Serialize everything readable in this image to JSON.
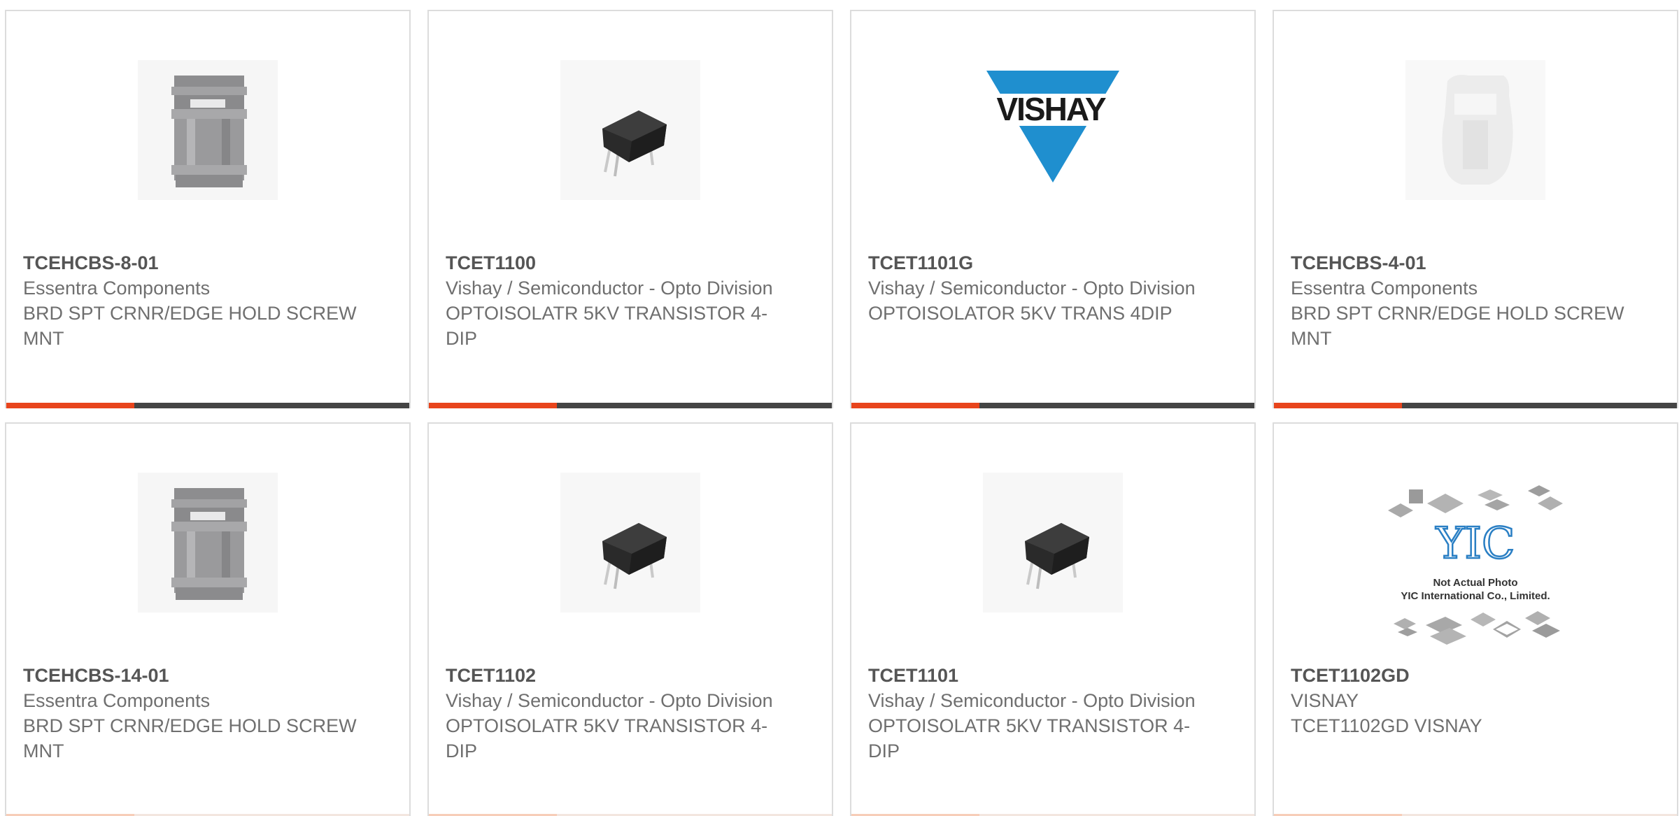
{
  "products": [
    {
      "image": "standoff-gray-icon",
      "part_number": "TCEHCBS-8-01",
      "manufacturer": "Essentra Components",
      "description": "BRD SPT CRNR/EDGE HOLD SCREW MNT"
    },
    {
      "image": "dip-optocoupler-icon",
      "part_number": "TCET1100",
      "manufacturer": "Vishay / Semiconductor - Opto Division",
      "description": "OPTOISOLATR 5KV TRANSISTOR 4-DIP"
    },
    {
      "image": "vishay-logo",
      "logo_text": "VISHAY",
      "part_number": "TCET1101G",
      "manufacturer": "Vishay / Semiconductor - Opto Division",
      "description": "OPTOISOLATOR 5KV TRANS 4DIP"
    },
    {
      "image": "standoff-white-icon",
      "part_number": "TCEHCBS-4-01",
      "manufacturer": "Essentra Components",
      "description": "BRD SPT CRNR/EDGE HOLD SCREW MNT"
    },
    {
      "image": "standoff-gray-icon",
      "part_number": "TCEHCBS-14-01",
      "manufacturer": "Essentra Components",
      "description": "BRD SPT CRNR/EDGE HOLD SCREW MNT"
    },
    {
      "image": "dip-optocoupler-icon",
      "part_number": "TCET1102",
      "manufacturer": "Vishay / Semiconductor - Opto Division",
      "description": "OPTOISOLATR 5KV TRANSISTOR 4-DIP"
    },
    {
      "image": "dip-optocoupler-icon",
      "part_number": "TCET1101",
      "manufacturer": "Vishay / Semiconductor - Opto Division",
      "description": "OPTOISOLATR 5KV TRANSISTOR 4-DIP"
    },
    {
      "image": "yic-placeholder-logo",
      "logo_text": "YIC",
      "placeholder_line1": "Not Actual Photo",
      "placeholder_line2": "YIC International Co., Limited.",
      "part_number": "TCET1102GD",
      "manufacturer": "VISNAY",
      "description": "TCET1102GD VISNAY"
    }
  ],
  "colors": {
    "accent": "#e8441c",
    "bar": "#444444",
    "border": "#dcdcdc",
    "text": "#6f6f6f",
    "vishay_blue": "#1f8fcf"
  }
}
